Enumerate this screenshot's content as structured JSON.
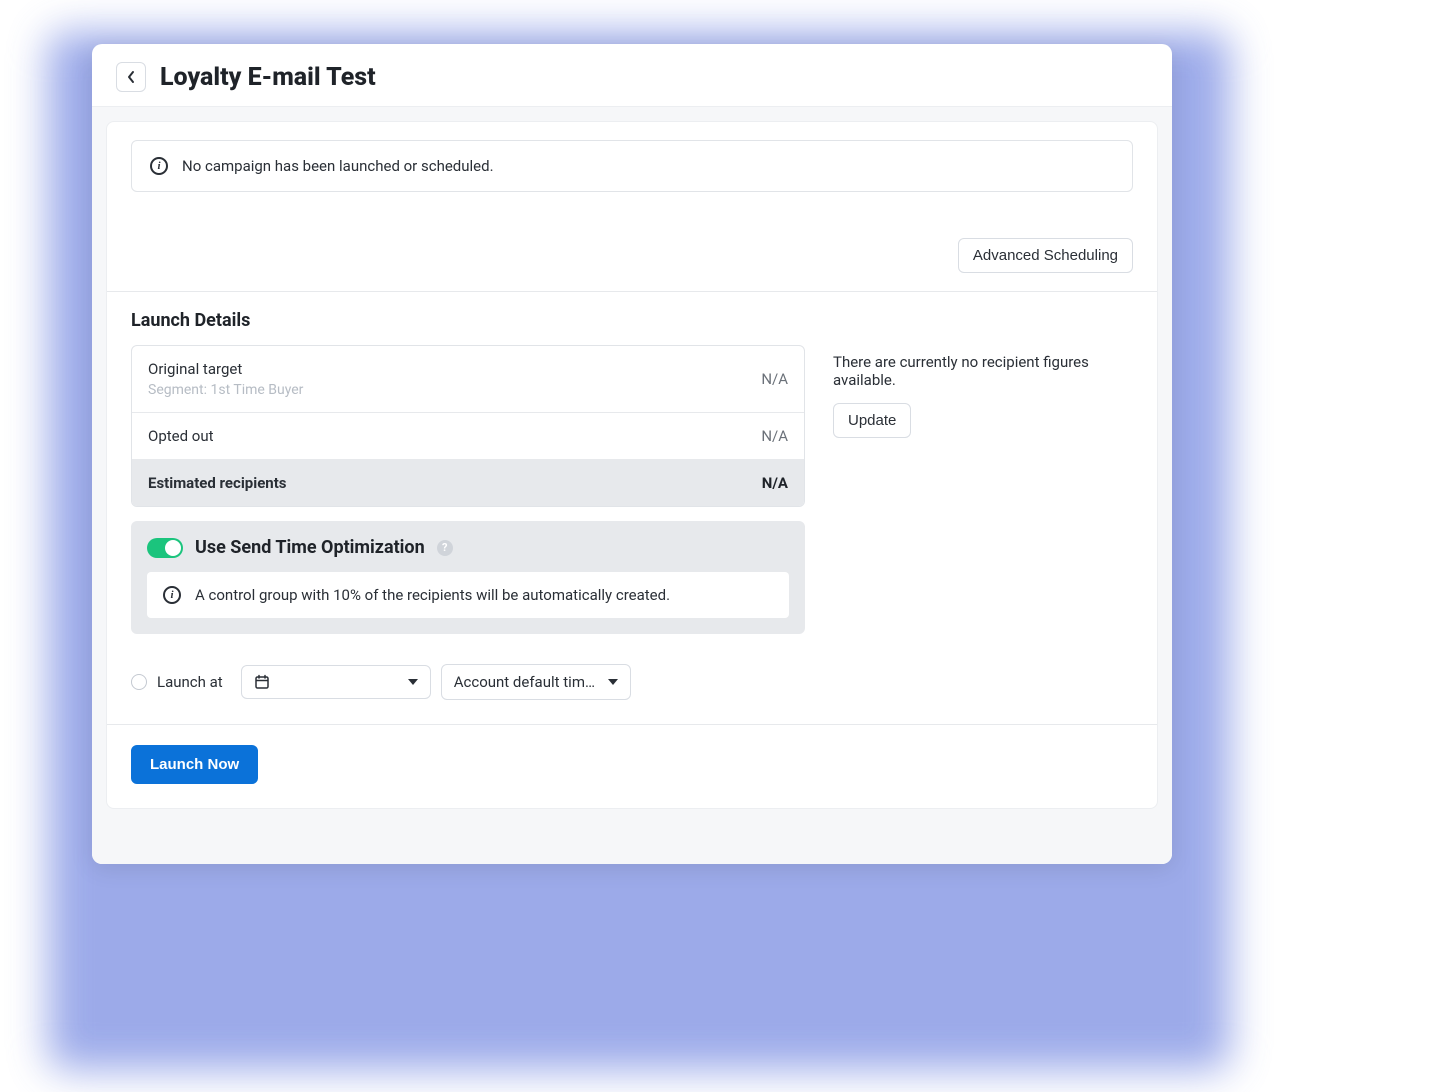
{
  "header": {
    "title": "Loyalty E-mail Test"
  },
  "banner": {
    "text": "No campaign has been launched or scheduled."
  },
  "buttons": {
    "advanced": "Advanced Scheduling",
    "update": "Update",
    "launch_now": "Launch Now"
  },
  "section": {
    "launch_details": "Launch Details"
  },
  "details": {
    "rows": [
      {
        "label": "Original target",
        "sub": "Segment: 1st Time Buyer",
        "value": "N/A"
      },
      {
        "label": "Opted out",
        "sub": null,
        "value": "N/A"
      },
      {
        "label": "Estimated recipients",
        "sub": null,
        "value": "N/A"
      }
    ]
  },
  "sto": {
    "title": "Use Send Time Optimization",
    "note": "A control group with 10% of the recipients will be automatically created."
  },
  "right": {
    "no_figures": "There are currently no recipient figures available."
  },
  "schedule": {
    "launch_at_label": "Launch at",
    "timezone": "Account default time z…"
  }
}
